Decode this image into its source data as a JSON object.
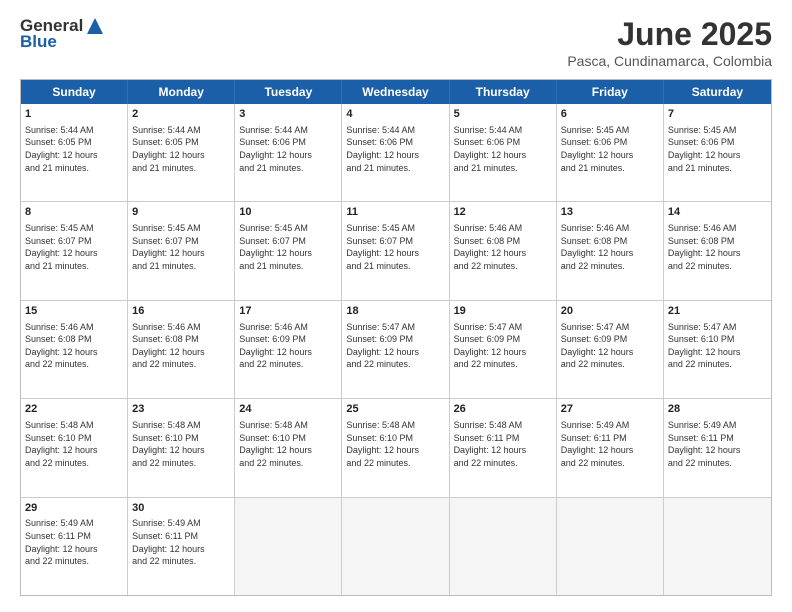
{
  "logo": {
    "general": "General",
    "blue": "Blue"
  },
  "title": "June 2025",
  "location": "Pasca, Cundinamarca, Colombia",
  "days": [
    "Sunday",
    "Monday",
    "Tuesday",
    "Wednesday",
    "Thursday",
    "Friday",
    "Saturday"
  ],
  "rows": [
    [
      {
        "day": "1",
        "sunrise": "5:44 AM",
        "sunset": "6:05 PM",
        "daylight": "12 hours and 21 minutes."
      },
      {
        "day": "2",
        "sunrise": "5:44 AM",
        "sunset": "6:05 PM",
        "daylight": "12 hours and 21 minutes."
      },
      {
        "day": "3",
        "sunrise": "5:44 AM",
        "sunset": "6:06 PM",
        "daylight": "12 hours and 21 minutes."
      },
      {
        "day": "4",
        "sunrise": "5:44 AM",
        "sunset": "6:06 PM",
        "daylight": "12 hours and 21 minutes."
      },
      {
        "day": "5",
        "sunrise": "5:44 AM",
        "sunset": "6:06 PM",
        "daylight": "12 hours and 21 minutes."
      },
      {
        "day": "6",
        "sunrise": "5:45 AM",
        "sunset": "6:06 PM",
        "daylight": "12 hours and 21 minutes."
      },
      {
        "day": "7",
        "sunrise": "5:45 AM",
        "sunset": "6:06 PM",
        "daylight": "12 hours and 21 minutes."
      }
    ],
    [
      {
        "day": "8",
        "sunrise": "5:45 AM",
        "sunset": "6:07 PM",
        "daylight": "12 hours and 21 minutes."
      },
      {
        "day": "9",
        "sunrise": "5:45 AM",
        "sunset": "6:07 PM",
        "daylight": "12 hours and 21 minutes."
      },
      {
        "day": "10",
        "sunrise": "5:45 AM",
        "sunset": "6:07 PM",
        "daylight": "12 hours and 21 minutes."
      },
      {
        "day": "11",
        "sunrise": "5:45 AM",
        "sunset": "6:07 PM",
        "daylight": "12 hours and 21 minutes."
      },
      {
        "day": "12",
        "sunrise": "5:46 AM",
        "sunset": "6:08 PM",
        "daylight": "12 hours and 22 minutes."
      },
      {
        "day": "13",
        "sunrise": "5:46 AM",
        "sunset": "6:08 PM",
        "daylight": "12 hours and 22 minutes."
      },
      {
        "day": "14",
        "sunrise": "5:46 AM",
        "sunset": "6:08 PM",
        "daylight": "12 hours and 22 minutes."
      }
    ],
    [
      {
        "day": "15",
        "sunrise": "5:46 AM",
        "sunset": "6:08 PM",
        "daylight": "12 hours and 22 minutes."
      },
      {
        "day": "16",
        "sunrise": "5:46 AM",
        "sunset": "6:08 PM",
        "daylight": "12 hours and 22 minutes."
      },
      {
        "day": "17",
        "sunrise": "5:46 AM",
        "sunset": "6:09 PM",
        "daylight": "12 hours and 22 minutes."
      },
      {
        "day": "18",
        "sunrise": "5:47 AM",
        "sunset": "6:09 PM",
        "daylight": "12 hours and 22 minutes."
      },
      {
        "day": "19",
        "sunrise": "5:47 AM",
        "sunset": "6:09 PM",
        "daylight": "12 hours and 22 minutes."
      },
      {
        "day": "20",
        "sunrise": "5:47 AM",
        "sunset": "6:09 PM",
        "daylight": "12 hours and 22 minutes."
      },
      {
        "day": "21",
        "sunrise": "5:47 AM",
        "sunset": "6:10 PM",
        "daylight": "12 hours and 22 minutes."
      }
    ],
    [
      {
        "day": "22",
        "sunrise": "5:48 AM",
        "sunset": "6:10 PM",
        "daylight": "12 hours and 22 minutes."
      },
      {
        "day": "23",
        "sunrise": "5:48 AM",
        "sunset": "6:10 PM",
        "daylight": "12 hours and 22 minutes."
      },
      {
        "day": "24",
        "sunrise": "5:48 AM",
        "sunset": "6:10 PM",
        "daylight": "12 hours and 22 minutes."
      },
      {
        "day": "25",
        "sunrise": "5:48 AM",
        "sunset": "6:10 PM",
        "daylight": "12 hours and 22 minutes."
      },
      {
        "day": "26",
        "sunrise": "5:48 AM",
        "sunset": "6:11 PM",
        "daylight": "12 hours and 22 minutes."
      },
      {
        "day": "27",
        "sunrise": "5:49 AM",
        "sunset": "6:11 PM",
        "daylight": "12 hours and 22 minutes."
      },
      {
        "day": "28",
        "sunrise": "5:49 AM",
        "sunset": "6:11 PM",
        "daylight": "12 hours and 22 minutes."
      }
    ],
    [
      {
        "day": "29",
        "sunrise": "5:49 AM",
        "sunset": "6:11 PM",
        "daylight": "12 hours and 22 minutes."
      },
      {
        "day": "30",
        "sunrise": "5:49 AM",
        "sunset": "6:11 PM",
        "daylight": "12 hours and 22 minutes."
      },
      {
        "day": "",
        "sunrise": "",
        "sunset": "",
        "daylight": ""
      },
      {
        "day": "",
        "sunrise": "",
        "sunset": "",
        "daylight": ""
      },
      {
        "day": "",
        "sunrise": "",
        "sunset": "",
        "daylight": ""
      },
      {
        "day": "",
        "sunrise": "",
        "sunset": "",
        "daylight": ""
      },
      {
        "day": "",
        "sunrise": "",
        "sunset": "",
        "daylight": ""
      }
    ]
  ],
  "labels": {
    "sunrise": "Sunrise:",
    "sunset": "Sunset:",
    "daylight": "Daylight:"
  }
}
